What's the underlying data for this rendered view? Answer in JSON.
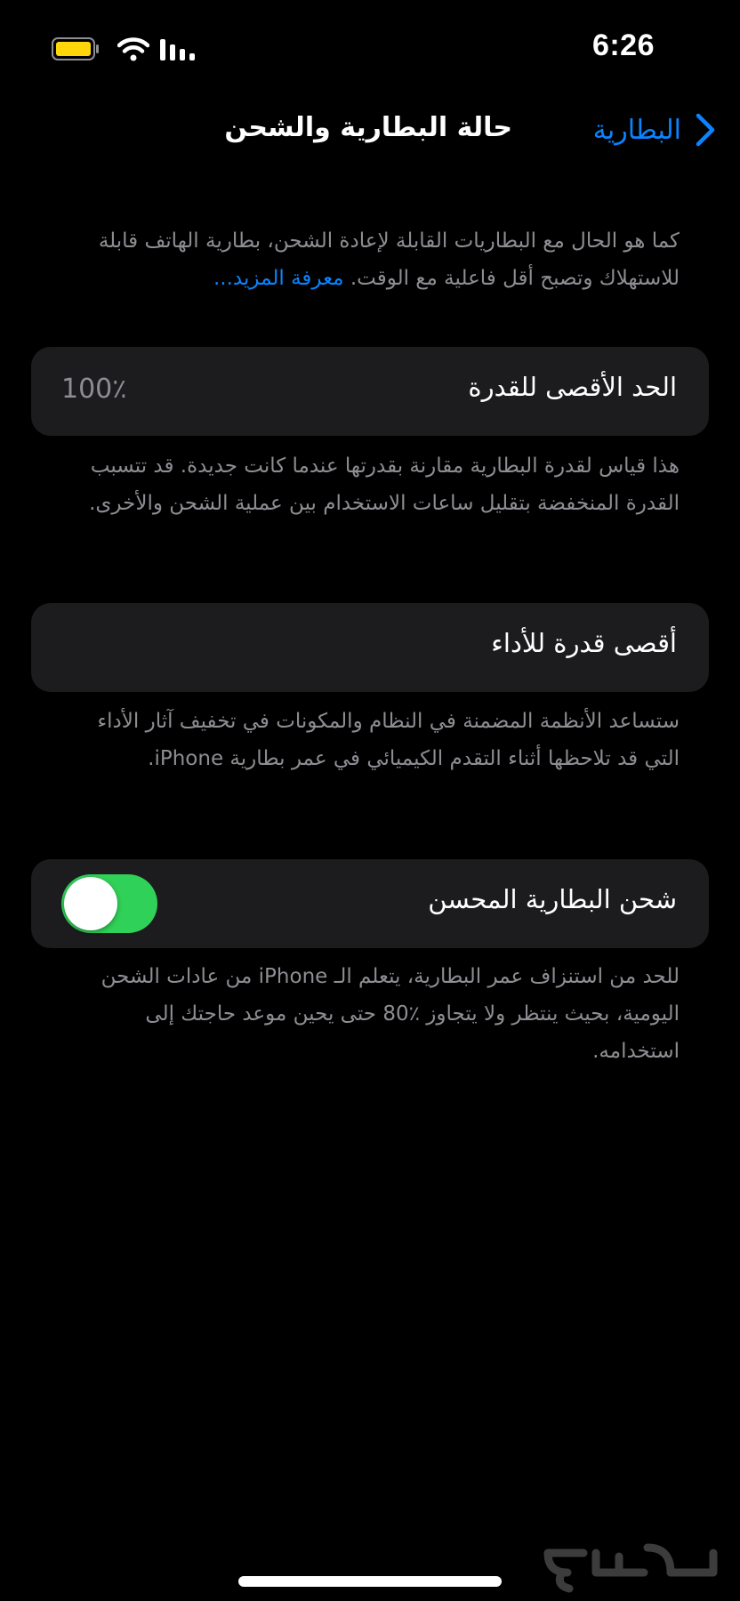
{
  "status_bar": {
    "time": "6:26",
    "battery_icon": "battery-low-power-icon",
    "wifi_icon": "wifi-icon",
    "signal_icon": "cellular-signal-icon",
    "battery_color": "#ffd60a"
  },
  "nav": {
    "back_label": "البطارية",
    "back_icon": "chevron-right-icon",
    "title": "حالة البطارية والشحن"
  },
  "intro": {
    "text": "كما هو الحال مع البطاريات القابلة لإعادة الشحن، بطارية الهاتف قابلة للاستهلاك وتصبح أقل فاعلية مع الوقت.",
    "link": "معرفة المزيد..."
  },
  "maximum_capacity": {
    "label": "الحد الأقصى للقدرة",
    "value": "100٪",
    "description": "هذا قياس لقدرة البطارية مقارنة بقدرتها عندما كانت جديدة. قد تتسبب القدرة المنخفضة بتقليل ساعات الاستخدام بين عملية الشحن والأخرى."
  },
  "peak_performance": {
    "label": "أقصى قدرة للأداء",
    "description": "ستساعد الأنظمة المضمنة في النظام والمكونات في تخفيف آثار الأداء التي قد تلاحظها أثناء التقدم الكيميائي في عمر بطارية iPhone."
  },
  "optimized_charging": {
    "label": "شحن البطارية المحسن",
    "enabled": true,
    "toggle_color": "#30d158",
    "description": "للحد من استنزاف عمر البطارية، يتعلم الـ iPhone من عادات الشحن اليومية، بحيث ينتظر ولا يتجاوز ٪80 حتى يحين موعد حاجتك إلى استخدامه."
  },
  "colors": {
    "background": "#000000",
    "cell": "#1c1c1e",
    "accent": "#0a84ff",
    "secondary_text": "#8d8d93"
  },
  "watermark": {
    "text": "حراج"
  }
}
